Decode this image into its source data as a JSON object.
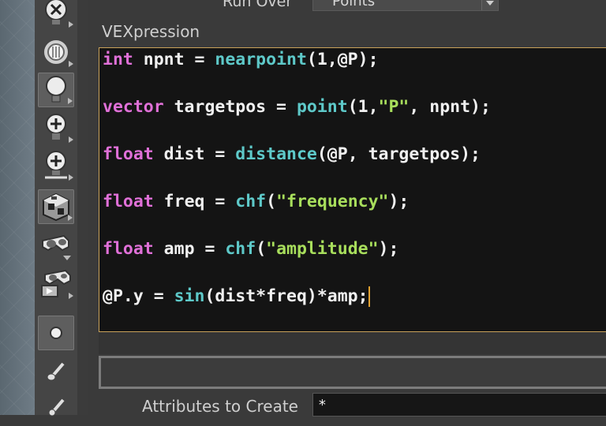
{
  "header": {
    "run_over_label": "Run Over",
    "run_over_value": "Points"
  },
  "vex": {
    "label": "VEXpression",
    "lines": [
      [
        {
          "t": "int",
          "c": "type"
        },
        {
          "t": " npnt = ",
          "c": "def"
        },
        {
          "t": "nearpoint",
          "c": "func"
        },
        {
          "t": "(1,@P);",
          "c": "def"
        }
      ],
      [
        {
          "t": "vector",
          "c": "type"
        },
        {
          "t": " targetpos = ",
          "c": "def"
        },
        {
          "t": "point",
          "c": "func"
        },
        {
          "t": "(1,",
          "c": "def"
        },
        {
          "t": "\"P\"",
          "c": "str"
        },
        {
          "t": ", npnt);",
          "c": "def"
        }
      ],
      [
        {
          "t": "float",
          "c": "type"
        },
        {
          "t": " dist = ",
          "c": "def"
        },
        {
          "t": "distance",
          "c": "func"
        },
        {
          "t": "(@P, targetpos);",
          "c": "def"
        }
      ],
      [
        {
          "t": "float",
          "c": "type"
        },
        {
          "t": " freq = ",
          "c": "def"
        },
        {
          "t": "chf",
          "c": "func"
        },
        {
          "t": "(",
          "c": "def"
        },
        {
          "t": "\"frequency\"",
          "c": "str"
        },
        {
          "t": ");",
          "c": "def"
        }
      ],
      [
        {
          "t": "float",
          "c": "type"
        },
        {
          "t": " amp = ",
          "c": "def"
        },
        {
          "t": "chf",
          "c": "func"
        },
        {
          "t": "(",
          "c": "def"
        },
        {
          "t": "\"amplitude\"",
          "c": "str"
        },
        {
          "t": ");",
          "c": "def"
        }
      ],
      [
        {
          "t": "@P.y = ",
          "c": "def"
        },
        {
          "t": "sin",
          "c": "func"
        },
        {
          "t": "(dist*freq)*amp;",
          "c": "def"
        }
      ]
    ],
    "colors": {
      "type": "#e070d8",
      "func": "#5ec9c9",
      "str": "#a8de5c",
      "default": "#f0f0f0",
      "caret": "#e0a030",
      "editor_border": "#c9a25a"
    }
  },
  "attributes": {
    "label": "Attributes to Create",
    "value": "*"
  },
  "shelf": {
    "tools": [
      {
        "icon": "remove-light-icon",
        "active": false
      },
      {
        "icon": "ambient-light-icon",
        "active": false
      },
      {
        "icon": "point-light-icon",
        "active": true
      },
      {
        "icon": "add-light-icon",
        "active": false
      },
      {
        "icon": "spot-light-icon",
        "active": false
      },
      {
        "icon": "environment-light-icon",
        "active": true
      },
      {
        "icon": "stereo-camera-icon",
        "active": false
      },
      {
        "icon": "vr-camera-icon",
        "active": false
      },
      {
        "icon": "null-object-icon",
        "active": true
      },
      {
        "icon": "brush-icon",
        "active": false
      },
      {
        "icon": "pen-icon",
        "active": false
      }
    ]
  }
}
